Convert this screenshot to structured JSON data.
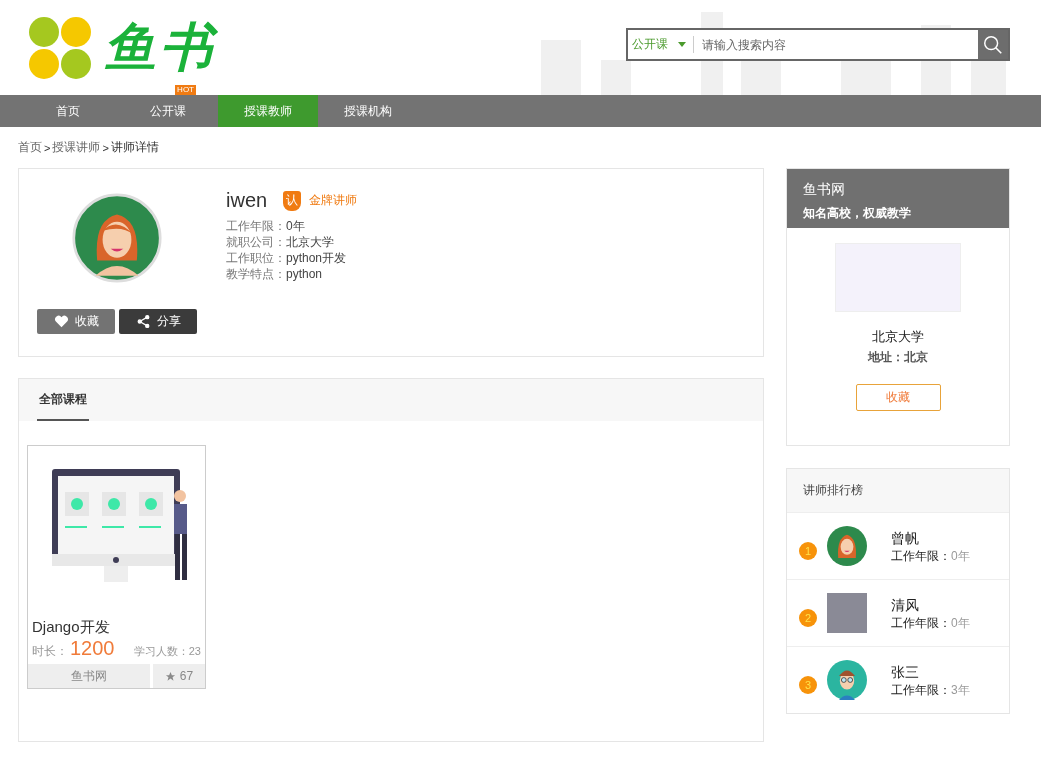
{
  "logo": {
    "text": "鱼书"
  },
  "search": {
    "category": "公开课",
    "placeholder": "请输入搜索内容"
  },
  "nav": [
    {
      "label": "首页",
      "selected": false
    },
    {
      "label": "公开课",
      "selected": false,
      "badge": "HOT"
    },
    {
      "label": "授课教师",
      "selected": true
    },
    {
      "label": "授课机构",
      "selected": false
    }
  ],
  "breadcrumb": [
    {
      "text": "首页",
      "kind": "link"
    },
    {
      "text": ">",
      "kind": "sep"
    },
    {
      "text": "授课讲师",
      "kind": "link"
    },
    {
      "text": ">",
      "kind": "sep"
    },
    {
      "text": "讲师详情",
      "kind": "current"
    }
  ],
  "teacher": {
    "name": "iwen",
    "badge_mark": "认",
    "title": "金牌讲师",
    "details": [
      {
        "label": "工作年限：",
        "value": "0年"
      },
      {
        "label": "就职公司：",
        "value": "北京大学"
      },
      {
        "label": "工作职位：",
        "value": "python开发"
      },
      {
        "label": "教学特点：",
        "value": "python"
      }
    ],
    "buttons": [
      {
        "label": "收藏",
        "kind": "favorite"
      },
      {
        "label": "分享",
        "kind": "share"
      }
    ]
  },
  "course_tabs": [
    {
      "label": "全部课程",
      "selected": true
    }
  ],
  "courses": [
    {
      "title": "Django开发",
      "duration_label": "时长：",
      "duration": "1200",
      "students_label": "学习人数：",
      "students": "23",
      "org": "鱼书网",
      "favorites": "67"
    }
  ],
  "org_card": {
    "name": "鱼书网",
    "slogan": "知名高校，权威教学",
    "school": "北京大学",
    "address": "地址：北京",
    "button": "收藏"
  },
  "ranking": {
    "title": "讲师排行榜",
    "items": [
      {
        "rank": "1",
        "name": "曾帆",
        "label": "工作年限：",
        "value": "0年",
        "kind": "woman"
      },
      {
        "rank": "2",
        "name": "清风",
        "label": "工作年限：",
        "value": "0年",
        "kind": "photo"
      },
      {
        "rank": "3",
        "name": "张三",
        "label": "工作年限：",
        "value": "3年",
        "kind": "man"
      }
    ]
  }
}
